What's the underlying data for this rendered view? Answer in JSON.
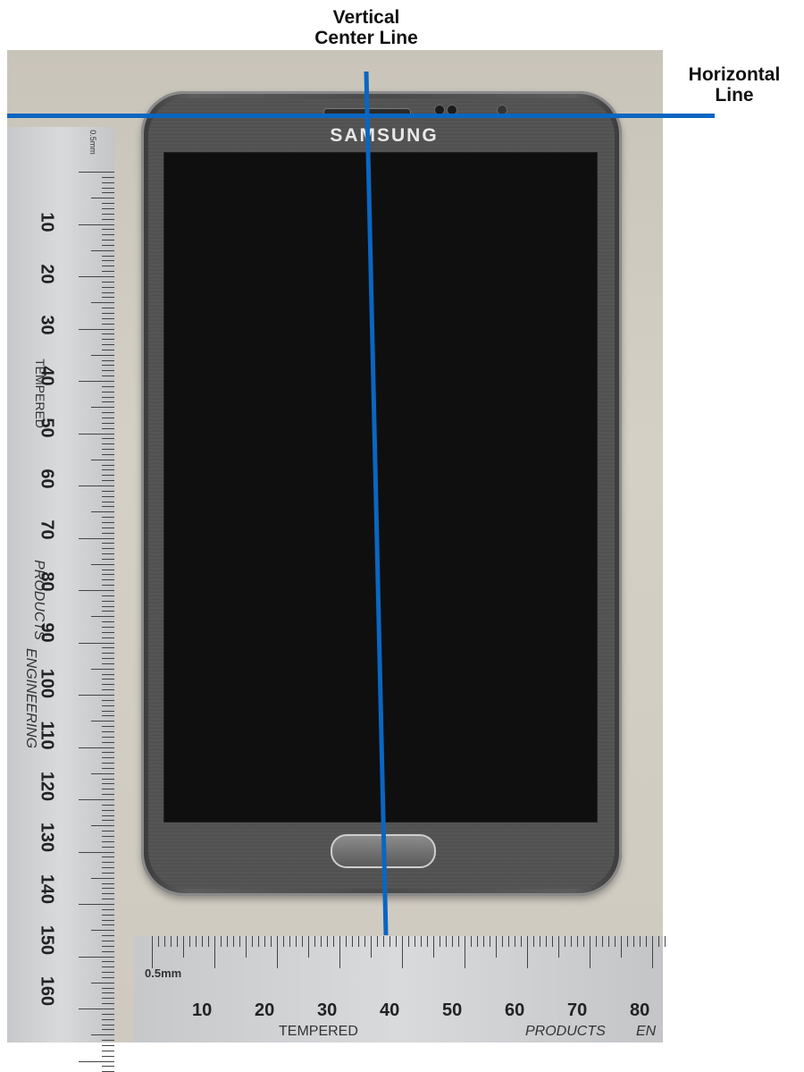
{
  "labels": {
    "vertical": "Vertical\nCenter Line",
    "horizontal": "Horizontal\nLine"
  },
  "phone": {
    "brand": "SAMSUNG"
  },
  "ruler_vertical": {
    "unit": "0.5mm",
    "word1": "TEMPERED",
    "word2": "PRODUCTS",
    "word3": "ENGINEERING",
    "numbers": [
      "10",
      "20",
      "30",
      "40",
      "50",
      "60",
      "70",
      "80",
      "90",
      "100",
      "110",
      "120",
      "130",
      "140",
      "150",
      "160"
    ]
  },
  "ruler_horizontal": {
    "unit": "0.5mm",
    "word1": "TEMPERED",
    "word2": "PRODUCTS",
    "word3": "EN",
    "numbers": [
      "10",
      "20",
      "30",
      "40",
      "50",
      "60",
      "70",
      "80"
    ]
  },
  "colors": {
    "guide_line": "#0a66c2"
  }
}
